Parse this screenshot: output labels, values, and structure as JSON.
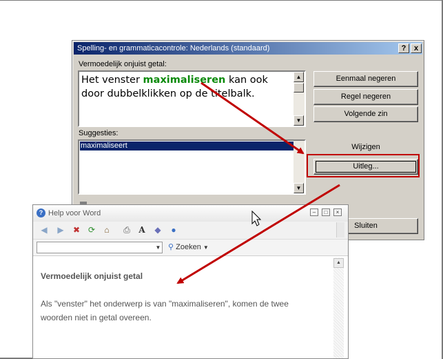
{
  "dialog": {
    "title": "Spelling- en grammaticacontrole: Nederlands (standaard)",
    "help_btn": "?",
    "close_btn": "x",
    "error_label": "Vermoedelijk onjuist getal:",
    "sentence_before": "Het venster ",
    "sentence_highlight": "maximaliseren",
    "sentence_after": " kan ook door dubbelklikken op de titelbalk.",
    "suggestions_label": "Suggesties:",
    "suggestions": [
      "maximaliseert"
    ],
    "buttons": {
      "ignore_once": "Eenmaal negeren",
      "ignore_rule": "Regel negeren",
      "next_sentence": "Volgende zin",
      "change": "Wijzigen",
      "explain": "Uitleg...",
      "close": "Sluiten"
    }
  },
  "help": {
    "title": "Help voor Word",
    "search_label": "Zoeken",
    "heading": "Vermoedelijk onjuist getal",
    "body": "Als \"venster\" het onderwerp is van \"maximaliseren\", komen de twee woorden niet in getal overeen."
  },
  "colors": {
    "annotation": "#c00000",
    "highlight": "#0a8a0a",
    "selection": "#0a246a"
  }
}
